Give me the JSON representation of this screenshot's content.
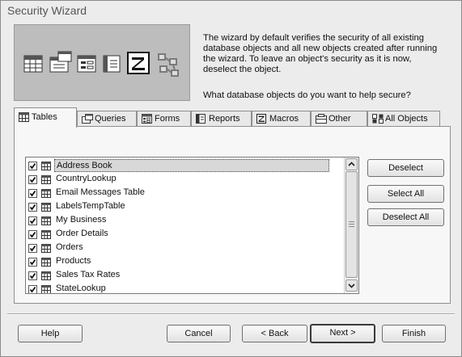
{
  "window": {
    "title": "Security Wizard"
  },
  "intro": {
    "line1": "The wizard by default verifies the security of all existing",
    "line2": "database objects and all new objects created after running",
    "line3": "the wizard. To leave an object's security as it is now,",
    "line4": "deselect the object.",
    "question": "What database objects do you want to help secure?"
  },
  "tabs": [
    {
      "label": "Tables",
      "icon": "table-icon",
      "active": true
    },
    {
      "label": "Queries",
      "icon": "query-icon"
    },
    {
      "label": "Forms",
      "icon": "form-icon"
    },
    {
      "label": "Reports",
      "icon": "report-icon"
    },
    {
      "label": "Macros",
      "icon": "macro-icon"
    },
    {
      "label": "Other",
      "icon": "other-icon"
    },
    {
      "label": "All Objects",
      "icon": "all-objects-icon"
    }
  ],
  "objects": [
    {
      "name": "Address Book",
      "checked": true,
      "selected": true
    },
    {
      "name": "CountryLookup",
      "checked": true
    },
    {
      "name": "Email Messages Table",
      "checked": true
    },
    {
      "name": "LabelsTempTable",
      "checked": true
    },
    {
      "name": "My Business",
      "checked": true
    },
    {
      "name": "Order Details",
      "checked": true
    },
    {
      "name": "Orders",
      "checked": true
    },
    {
      "name": "Products",
      "checked": true
    },
    {
      "name": "Sales Tax Rates",
      "checked": true
    },
    {
      "name": "StateLookup",
      "checked": true
    }
  ],
  "side_buttons": {
    "deselect": "Deselect",
    "select_all": "Select All",
    "deselect_all": "Deselect All"
  },
  "footer": {
    "help": "Help",
    "cancel": "Cancel",
    "back": "< Back",
    "next": "Next >",
    "finish": "Finish"
  }
}
